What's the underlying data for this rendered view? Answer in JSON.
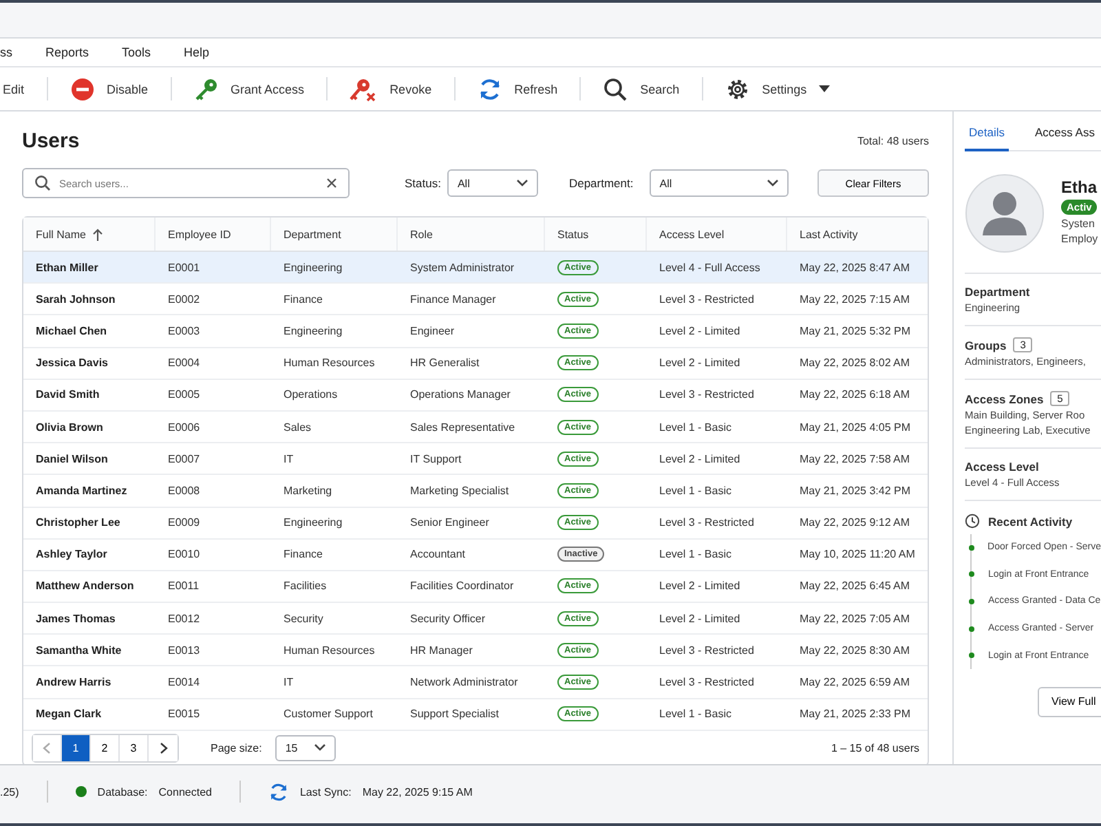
{
  "menu": [
    "ss",
    "Reports",
    "Tools",
    "Help"
  ],
  "toolbar": [
    {
      "label": "Edit",
      "dropdown": false
    },
    {
      "label": "Disable",
      "dropdown": false
    },
    {
      "label": "Grant Access",
      "dropdown": false
    },
    {
      "label": "Revoke",
      "dropdown": false
    },
    {
      "label": "Refresh",
      "dropdown": false
    },
    {
      "label": "Search",
      "dropdown": false
    },
    {
      "label": "Settings",
      "dropdown": true
    }
  ],
  "users": {
    "title": "Users",
    "total": "Total: 48 users",
    "search": {
      "placeholder": "Search users..."
    },
    "filters": [
      {
        "label": "Status:",
        "value": "All"
      },
      {
        "label": "Department:",
        "value": "All"
      }
    ],
    "clear_button": "Clear Filters",
    "table": {
      "columns": [
        {
          "label": "Full Name",
          "sorted": true
        },
        {
          "label": "Employee ID",
          "sorted": false
        },
        {
          "label": "Department",
          "sorted": false
        },
        {
          "label": "Role",
          "sorted": false
        },
        {
          "label": "Status",
          "sorted": false
        },
        {
          "label": "Access Level",
          "sorted": false
        },
        {
          "label": "Last Activity",
          "sorted": false
        }
      ],
      "rows": [
        {
          "name": "Ethan Miller",
          "id": "E0001",
          "department": "Engineering",
          "role": "System Administrator",
          "status": "Active",
          "active": true,
          "access": "Level 4 - Full Access",
          "last": "May 22, 2025 8:47 AM",
          "selected": true
        },
        {
          "name": "Sarah Johnson",
          "id": "E0002",
          "department": "Finance",
          "role": "Finance Manager",
          "status": "Active",
          "active": true,
          "access": "Level 3 - Restricted",
          "last": "May 22, 2025 7:15 AM",
          "selected": false
        },
        {
          "name": "Michael Chen",
          "id": "E0003",
          "department": "Engineering",
          "role": "Engineer",
          "status": "Active",
          "active": true,
          "access": "Level 2 - Limited",
          "last": "May 21, 2025 5:32 PM",
          "selected": false
        },
        {
          "name": "Jessica Davis",
          "id": "E0004",
          "department": "Human Resources",
          "role": "HR Generalist",
          "status": "Active",
          "active": true,
          "access": "Level 2 - Limited",
          "last": "May 22, 2025 8:02 AM",
          "selected": false
        },
        {
          "name": "David Smith",
          "id": "E0005",
          "department": "Operations",
          "role": "Operations Manager",
          "status": "Active",
          "active": true,
          "access": "Level 3 - Restricted",
          "last": "May 22, 2025 6:18 AM",
          "selected": false
        },
        {
          "name": "Olivia Brown",
          "id": "E0006",
          "department": "Sales",
          "role": "Sales Representative",
          "status": "Active",
          "active": true,
          "access": "Level 1 - Basic",
          "last": "May 21, 2025 4:05 PM",
          "selected": false
        },
        {
          "name": "Daniel Wilson",
          "id": "E0007",
          "department": "IT",
          "role": "IT Support",
          "status": "Active",
          "active": true,
          "access": "Level 2 - Limited",
          "last": "May 22, 2025 7:58 AM",
          "selected": false
        },
        {
          "name": "Amanda Martinez",
          "id": "E0008",
          "department": "Marketing",
          "role": "Marketing Specialist",
          "status": "Active",
          "active": true,
          "access": "Level 1 - Basic",
          "last": "May 21, 2025 3:42 PM",
          "selected": false
        },
        {
          "name": "Christopher Lee",
          "id": "E0009",
          "department": "Engineering",
          "role": "Senior Engineer",
          "status": "Active",
          "active": true,
          "access": "Level 3 - Restricted",
          "last": "May 22, 2025 9:12 AM",
          "selected": false
        },
        {
          "name": "Ashley Taylor",
          "id": "E0010",
          "department": "Finance",
          "role": "Accountant",
          "status": "Inactive",
          "active": false,
          "access": "Level 1 - Basic",
          "last": "May 10, 2025 11:20 AM",
          "selected": false
        },
        {
          "name": "Matthew Anderson",
          "id": "E0011",
          "department": "Facilities",
          "role": "Facilities Coordinator",
          "status": "Active",
          "active": true,
          "access": "Level 2 - Limited",
          "last": "May 22, 2025 6:45 AM",
          "selected": false
        },
        {
          "name": "James Thomas",
          "id": "E0012",
          "department": "Security",
          "role": "Security Officer",
          "status": "Active",
          "active": true,
          "access": "Level 2 - Limited",
          "last": "May 22, 2025 7:05 AM",
          "selected": false
        },
        {
          "name": "Samantha White",
          "id": "E0013",
          "department": "Human Resources",
          "role": "HR Manager",
          "status": "Active",
          "active": true,
          "access": "Level 3 - Restricted",
          "last": "May 22, 2025 8:30 AM",
          "selected": false
        },
        {
          "name": "Andrew Harris",
          "id": "E0014",
          "department": "IT",
          "role": "Network Administrator",
          "status": "Active",
          "active": true,
          "access": "Level 3 - Restricted",
          "last": "May 22, 2025 6:59 AM",
          "selected": false
        },
        {
          "name": "Megan Clark",
          "id": "E0015",
          "department": "Customer Support",
          "role": "Support Specialist",
          "status": "Active",
          "active": true,
          "access": "Level 1 - Basic",
          "last": "May 21, 2025 2:33 PM",
          "selected": false
        }
      ]
    },
    "pagination": {
      "pages": [
        {
          "label": "1",
          "selected": true
        },
        {
          "label": "2",
          "selected": false
        },
        {
          "label": "3",
          "selected": false
        }
      ],
      "page_size_label": "Page size:",
      "page_size": "15",
      "summary": "1 – 15 of 48 users"
    }
  },
  "details": {
    "tabs": [
      {
        "label": "Details",
        "selected": true
      },
      {
        "label": "Access Ass",
        "selected": false
      }
    ],
    "name": "Etha",
    "status": "Activ",
    "active": true,
    "role": "Systen",
    "employee": "Employ",
    "sections": [
      {
        "label": "Department",
        "lines": [
          "Engineering"
        ]
      },
      {
        "label": "Groups",
        "count": "3",
        "lines": [
          "Administrators, Engineers,"
        ]
      },
      {
        "label": "Access Zones",
        "count": "5",
        "lines": [
          "Main Building, Server Roo",
          "Engineering Lab, Executive"
        ]
      },
      {
        "label": "Access Level",
        "lines": [
          "Level 4 - Full Access"
        ]
      }
    ],
    "activity_title": "Recent Activity",
    "activity": [
      "Door Forced Open - Serve",
      "Login at Front Entrance",
      "Access Granted - Data Ce",
      "Access Granted - Server",
      "Login at Front Entrance"
    ],
    "view_button": "View Full"
  },
  "status_bar": {
    "version": ".25)",
    "database_label": "Database:",
    "database": "Connected",
    "connected": true,
    "sync_label": "Last Sync:",
    "sync": "May 22, 2025 9:15 AM"
  }
}
